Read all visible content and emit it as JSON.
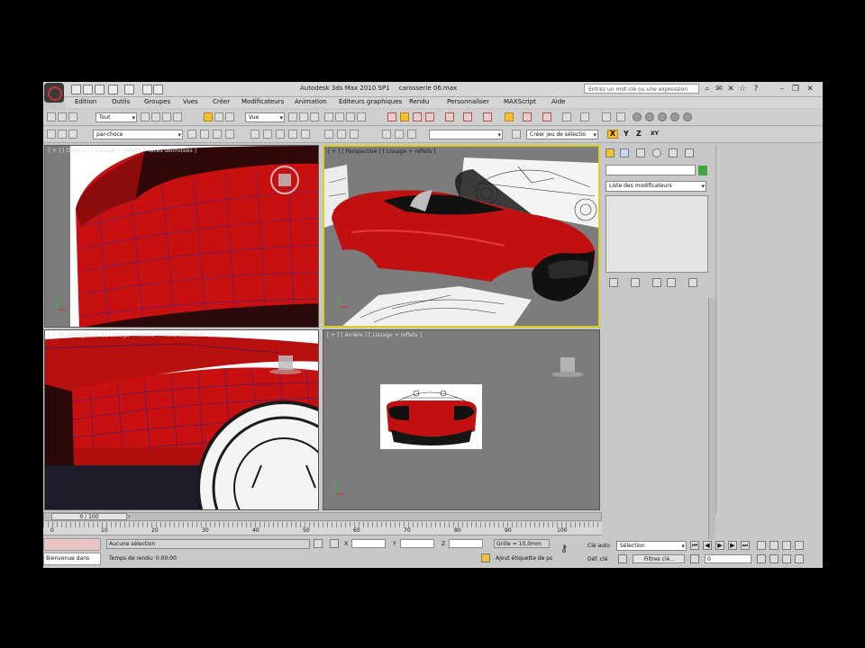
{
  "titlebar": {
    "title": "Autodesk 3ds Max 2010 SP1",
    "filename": "carosserie 06.max",
    "search_placeholder": "Entrez un mot-clé ou une expression"
  },
  "menu": [
    "Edition",
    "Outils",
    "Groupes",
    "Vues",
    "Créer",
    "Modificateurs",
    "Animation",
    "Editeurs graphiques",
    "Rendu",
    "Personnaliser",
    "MAXScript",
    "Aide"
  ],
  "toolbar": {
    "filter_dropdown": "Tout",
    "coord_dropdown": "Vue",
    "layer_dropdown": "par-choce",
    "selection_set": "Créer jeu de sélectio",
    "axis_x": "X",
    "axis_y": "Y",
    "axis_z": "Z",
    "axis_xy": "XY"
  },
  "viewports": {
    "top_left": "[ + ] [ Dessus ] [ Lissage + reflets + faces délimitées ]",
    "top_right": "[ + ] [ Perspective ] [ Lissage + reflets ]",
    "bottom_left": "[ + ] [ Orthogonale ] [ Lissage + reflets + faces délimitées ]",
    "bottom_right": "[ + ] [ Arrière ] [ Lissage + reflets ]"
  },
  "command_panel": {
    "modifier_list": "Liste des modificateurs",
    "name_color": "#3ea83e"
  },
  "timeline": {
    "frame_counter": "0 / 100",
    "ticks": [
      "0",
      "10",
      "20",
      "30",
      "40",
      "50",
      "60",
      "70",
      "80",
      "90",
      "100"
    ]
  },
  "status": {
    "selection_status": "Aucune sélection",
    "render_time": "Temps de rendu: 0:00:00",
    "welcome": "Bienvenue dans",
    "x_label": "X",
    "y_label": "Y",
    "z_label": "Z",
    "grid": "Grille = 10,0mm",
    "add_time_tag": "Ajout étiquette de ps",
    "auto_key": "Clé auto",
    "set_key": "Déf. clé",
    "selection_dd": "Sélection",
    "key_filters": "Filtres clé...",
    "current_frame": "0"
  },
  "colors": {
    "car_red": "#cc1010",
    "active_viewport": "#d8d020",
    "viewport_bg": "#7c7c7c"
  }
}
